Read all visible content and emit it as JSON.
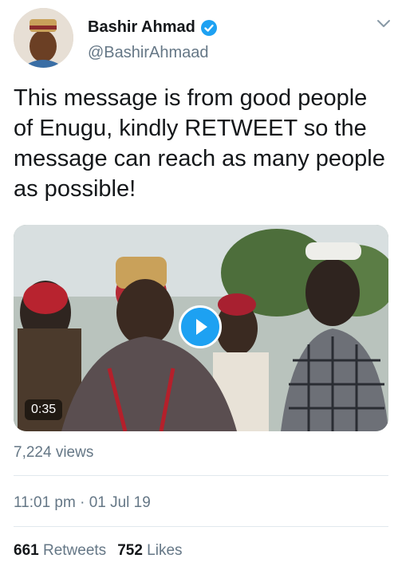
{
  "author": {
    "name": "Bashir Ahmad",
    "handle": "@BashirAhmaad",
    "verified": true
  },
  "tweet": {
    "text": "This message is from good people of Enugu, kindly RETWEET so the message can reach as many people as possible!"
  },
  "video": {
    "duration": "0:35",
    "play_icon": "play-icon"
  },
  "views": "7,224 views",
  "timestamp": "11:01 pm · 01 Jul 19",
  "stats": {
    "retweets_count": "661",
    "retweets_label": "Retweets",
    "likes_count": "752",
    "likes_label": "Likes"
  },
  "colors": {
    "accent": "#1da1f2",
    "muted_text": "#657786",
    "divider": "#e1e8ed"
  }
}
